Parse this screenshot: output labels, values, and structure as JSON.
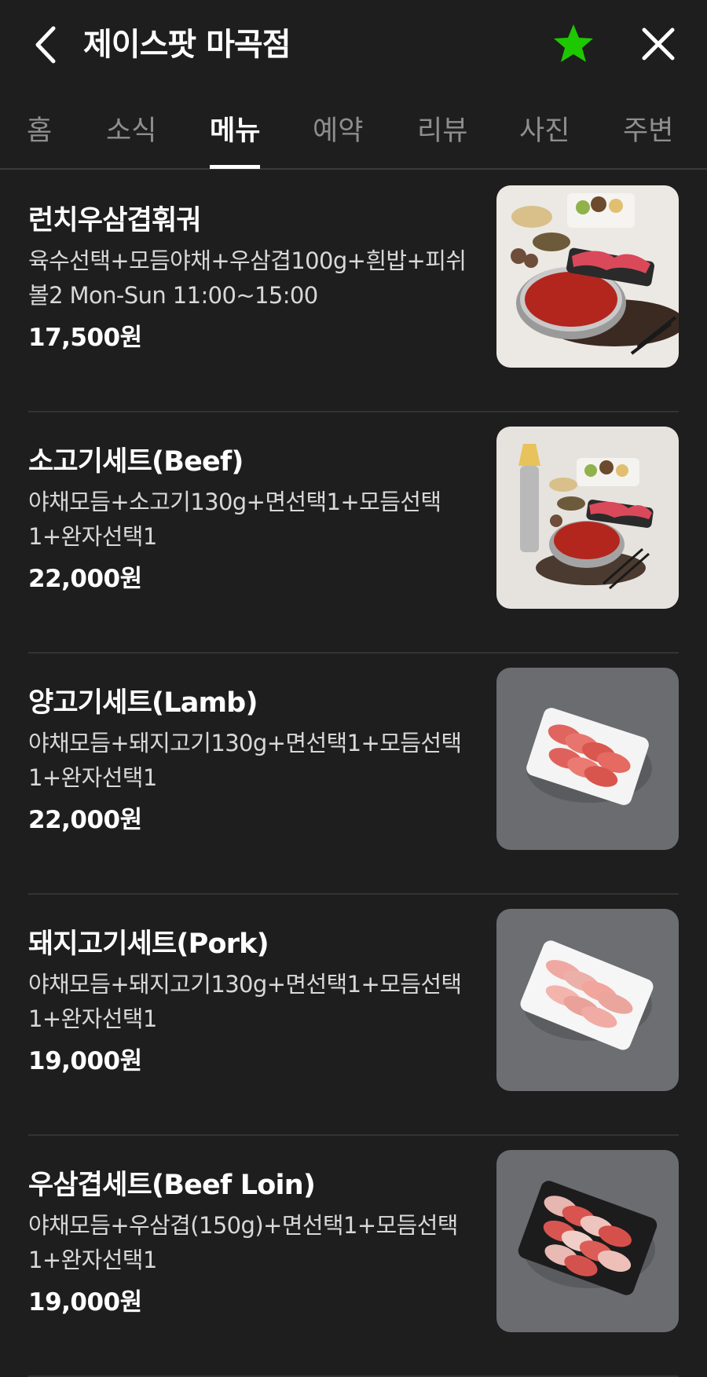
{
  "header": {
    "title": "제이스팟 마곡점",
    "back_icon": "chevron-left-icon",
    "favorite_icon": "star-icon",
    "close_icon": "close-icon",
    "favorite_color": "#1ec800"
  },
  "tabs": [
    {
      "label": "홈",
      "active": false
    },
    {
      "label": "소식",
      "active": false
    },
    {
      "label": "메뉴",
      "active": true
    },
    {
      "label": "예약",
      "active": false
    },
    {
      "label": "리뷰",
      "active": false
    },
    {
      "label": "사진",
      "active": false
    },
    {
      "label": "주변",
      "active": false
    }
  ],
  "menu": [
    {
      "name": "런치우삼겹훠궈",
      "description": "육수선택+모듬야채+우삼겹100g+흰밥+피쉬볼2 Mon-Sun 11:00~15:00",
      "price": "17,500원",
      "image": "hotpot-set-photo"
    },
    {
      "name": "소고기세트(Beef)",
      "description": "야채모듬+소고기130g+면선택1+모듬선택1+완자선택1",
      "price": "22,000원",
      "image": "hotpot-set-photo"
    },
    {
      "name": "양고기세트(Lamb)",
      "description": "야채모듬+돼지고기130g+면선택1+모듬선택1+완자선택1",
      "price": "22,000원",
      "image": "meat-plate-photo"
    },
    {
      "name": "돼지고기세트(Pork)",
      "description": "야채모듬+돼지고기130g+면선택1+모듬선택1+완자선택1",
      "price": "19,000원",
      "image": "meat-plate-photo"
    },
    {
      "name": "우삼겹세트(Beef Loin)",
      "description": "야채모듬+우삼겹(150g)+면선택1+모듬선택1+완자선택1",
      "price": "19,000원",
      "image": "meat-plate-photo"
    }
  ]
}
